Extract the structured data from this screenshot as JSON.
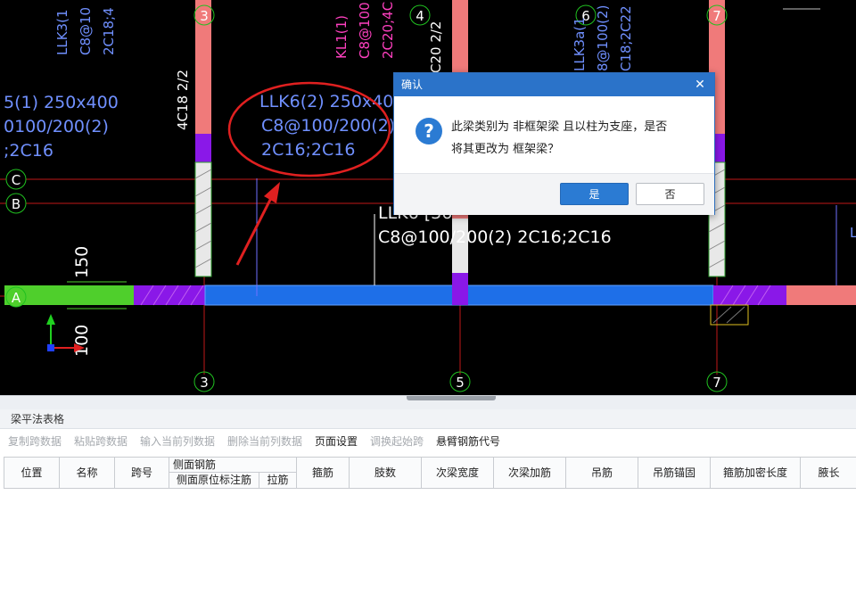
{
  "cad": {
    "axis_labels": {
      "top": [
        "3",
        "4",
        "6",
        "7"
      ],
      "bottom": [
        "3",
        "5",
        "7"
      ],
      "left": [
        "C",
        "B",
        "A"
      ]
    },
    "annotations": {
      "llk3": [
        "LLK3(1",
        "C8@10",
        "2C18;4"
      ],
      "kl1": [
        "KL1(1)",
        "C8@100",
        "2C20;4C"
      ],
      "col_c20": "C20 2/2",
      "llk3a": [
        "LLK3a(1",
        "8@100(2)",
        "C18;2C22"
      ],
      "left_beam": [
        "5(1) 250x400",
        "0100/200(2)",
        ";2C16"
      ],
      "col_4c18": "4C18 2/2",
      "circled_llk6": [
        "LLK6(2) 250x400",
        "C8@100/200(2)",
        "2C16;2C16"
      ],
      "llk6_repeat": [
        "LLK6 [36",
        "C8@100/200(2) 2C16;2C16"
      ],
      "dim_150": "150",
      "dim_100": "100"
    },
    "colors": {
      "beam_blue": "#1e6fe8",
      "beam_pink": "#f07a7a",
      "purple": "#8a18e8",
      "green": "#4fcf2c",
      "circle_red": "#e02020"
    }
  },
  "dialog": {
    "title": "确认",
    "close_icon": "close-icon",
    "question_icon": "?",
    "message_line1": "此梁类别为 非框架梁 且以柱为支座，是否",
    "message_line2": "将其更改为 框架梁？",
    "yes_label": "是",
    "no_label": "否"
  },
  "panel": {
    "title": "梁平法表格",
    "toolbar": [
      {
        "label": "复制跨数据",
        "enabled": false
      },
      {
        "label": "粘贴跨数据",
        "enabled": false
      },
      {
        "label": "输入当前列数据",
        "enabled": false
      },
      {
        "label": "删除当前列数据",
        "enabled": false
      },
      {
        "label": "页面设置",
        "enabled": true
      },
      {
        "label": "调换起始跨",
        "enabled": false
      },
      {
        "label": "悬臂钢筋代号",
        "enabled": true
      }
    ],
    "columns": {
      "pos": "位置",
      "name": "名称",
      "span": "跨号",
      "side_group": "侧面钢筋",
      "side_mark": "侧面原位标注筋",
      "tie": "拉筋",
      "stirrup": "箍筋",
      "legs": "肢数",
      "sec_width": "次梁宽度",
      "sec_add": "次梁加筋",
      "hanger": "吊筋",
      "hanger_anchor": "吊筋锚固",
      "stirrup_dense": "箍筋加密长度",
      "haunch": "腋长"
    }
  }
}
